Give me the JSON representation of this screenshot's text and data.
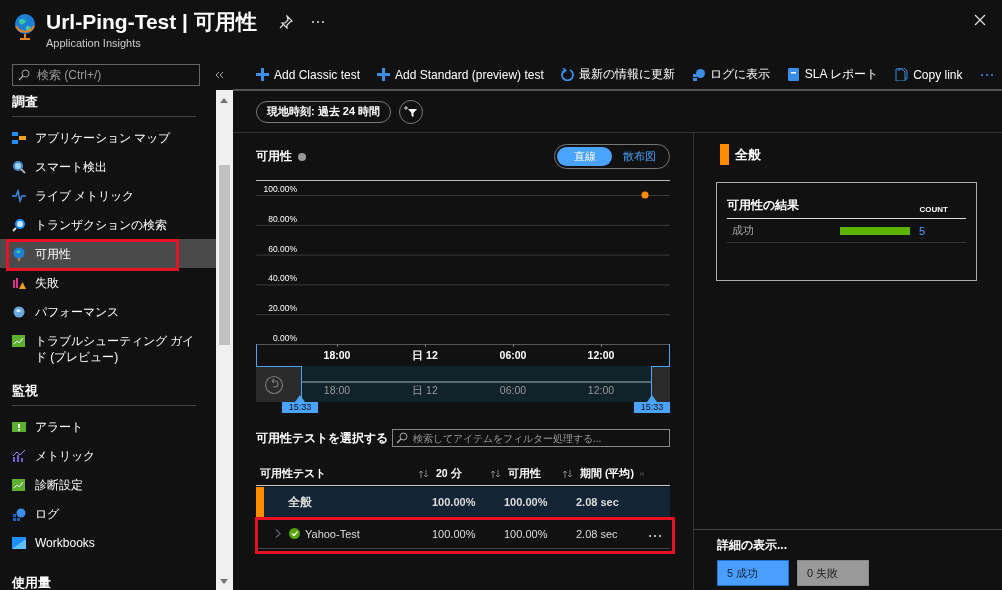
{
  "header": {
    "title": "Url-Ping-Test | 可用性",
    "subtitle": "Application Insights"
  },
  "sidebar": {
    "search": {
      "placeholder": "検索 (Ctrl+/)"
    },
    "sections": [
      {
        "title": "調査",
        "items": [
          {
            "label": "アプリケーション マップ",
            "selected": false,
            "highlighted": false
          },
          {
            "label": "スマート検出",
            "selected": false,
            "highlighted": false
          },
          {
            "label": "ライブ メトリック",
            "selected": false,
            "highlighted": false
          },
          {
            "label": "トランザクションの検索",
            "selected": false,
            "highlighted": false
          },
          {
            "label": "可用性",
            "selected": true,
            "highlighted": true
          },
          {
            "label": "失敗",
            "selected": false,
            "highlighted": false
          },
          {
            "label": "パフォーマンス",
            "selected": false,
            "highlighted": false
          },
          {
            "label": "トラブルシューティング ガイド (プレビュー)",
            "selected": false,
            "highlighted": false
          }
        ]
      },
      {
        "title": "監視",
        "items": [
          {
            "label": "アラート",
            "selected": false,
            "highlighted": false
          },
          {
            "label": "メトリック",
            "selected": false,
            "highlighted": false
          },
          {
            "label": "診断設定",
            "selected": false,
            "highlighted": false
          },
          {
            "label": "ログ",
            "selected": false,
            "highlighted": false
          },
          {
            "label": "Workbooks",
            "selected": false,
            "highlighted": false
          }
        ]
      },
      {
        "title": "使用量"
      }
    ]
  },
  "toolbar": {
    "buttons": [
      {
        "label": "Add Classic test"
      },
      {
        "label": "Add Standard (preview) test"
      },
      {
        "label": "最新の情報に更新"
      },
      {
        "label": "ログに表示"
      },
      {
        "label": "SLA レポート"
      },
      {
        "label": "Copy link"
      }
    ]
  },
  "time_filter": {
    "label": "現地時刻: 過去 24 時間"
  },
  "availability_chart": {
    "view_toggle": [
      {
        "label": "直線",
        "selected": true
      },
      {
        "label": "散布図",
        "selected": false
      }
    ],
    "chart_data": {
      "type": "line",
      "title": "可用性",
      "categories": [
        null,
        "18:00",
        null,
        "日 12",
        null,
        "06:00",
        null,
        "12:00",
        null
      ],
      "series": [
        {
          "color": "#ff8c00",
          "marker": "circle",
          "values": [
            null,
            null,
            null,
            null,
            null,
            null,
            null,
            null,
            100
          ]
        }
      ],
      "ylim": [
        0,
        100
      ],
      "yticks": [
        {
          "value": 0,
          "label": "0.00%"
        },
        {
          "value": 20,
          "label": "20.00%"
        },
        {
          "value": 40,
          "label": "40.00%"
        },
        {
          "value": 60,
          "label": "60.00%"
        },
        {
          "value": 80,
          "label": "80.00%"
        },
        {
          "value": 100,
          "label": "100.00%"
        }
      ]
    },
    "brush": {
      "labels": [
        "18:00",
        "日 12",
        "06:00",
        "12:00"
      ],
      "start_label": "15:33",
      "end_label": "15:33"
    }
  },
  "test_list": {
    "title": "可用性テストを選択する",
    "search": {
      "placeholder": "検索してアイテムをフィルター処理する..."
    },
    "columns": [
      "可用性テスト",
      "20 分",
      "可用性",
      "期間 (平均)"
    ],
    "rows": [
      {
        "kind": "summary",
        "cells": [
          "全般",
          "100.00%",
          "100.00%",
          "2.08 sec"
        ],
        "highlighted": false
      },
      {
        "kind": "test",
        "passed": true,
        "expanded": false,
        "cells": [
          "Yahoo-Test",
          "100.00%",
          "100.00%",
          "2.08 sec"
        ],
        "highlighted": true
      }
    ]
  },
  "summary_panel": {
    "title": "全般",
    "results": {
      "title": "可用性の結果",
      "count_heading": "COUNT",
      "rows": [
        {
          "label": "成功",
          "level": 1,
          "count": "5"
        }
      ]
    },
    "details": {
      "title": "詳細の表示...",
      "filters": [
        {
          "label": "5 成功",
          "selected": true
        },
        {
          "label": "0 失敗",
          "selected": false
        }
      ]
    }
  }
}
